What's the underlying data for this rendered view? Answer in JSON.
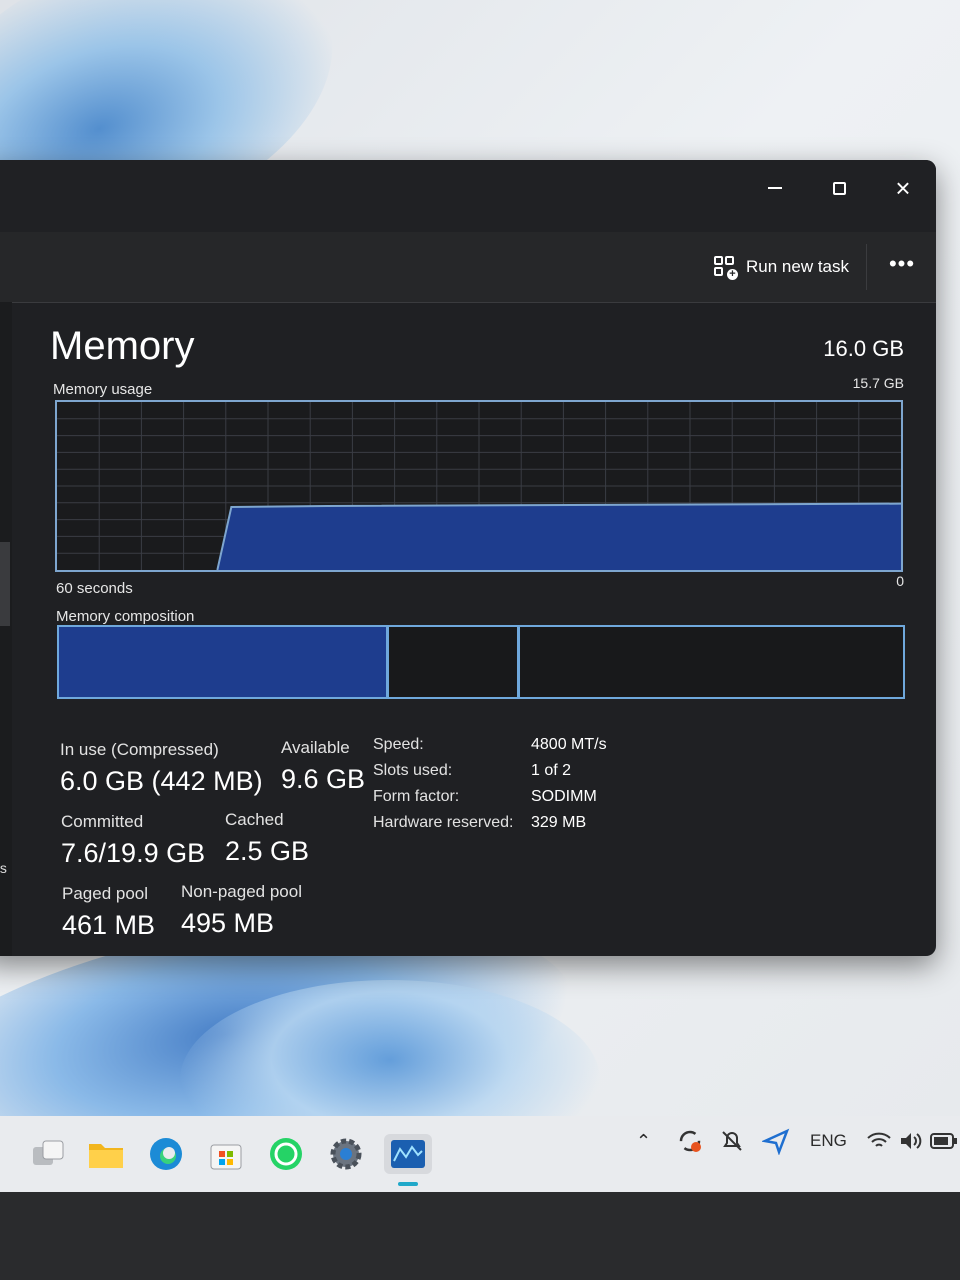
{
  "window": {
    "title_buttons": {
      "minimize": "minimize",
      "maximize": "maximize",
      "close": "×"
    },
    "command_bar": {
      "run_new_task": "Run new task",
      "more_options": "•••"
    },
    "left_nav_fragments": [
      "ts",
      "..."
    ]
  },
  "memory": {
    "title": "Memory",
    "total": "16.0 GB",
    "usage_label": "Memory usage",
    "usage_max": "15.7 GB",
    "time_label": "60 seconds",
    "zero_label": "0",
    "composition_label": "Memory composition",
    "composition": {
      "in_use_fraction": 0.39,
      "modified_fraction": 0.155,
      "free_fraction": 0.455
    },
    "usage_history": {
      "start_fraction": 0.19,
      "level_fraction_start": 0.375,
      "level_fraction_end": 0.395
    },
    "stats": {
      "in_use_label": "In use (Compressed)",
      "in_use_value": "6.0 GB (442 MB)",
      "available_label": "Available",
      "available_value": "9.6 GB",
      "committed_label": "Committed",
      "committed_value": "7.6/19.9 GB",
      "cached_label": "Cached",
      "cached_value": "2.5 GB",
      "paged_pool_label": "Paged pool",
      "paged_pool_value": "461 MB",
      "nonpaged_pool_label": "Non-paged pool",
      "nonpaged_pool_value": "495 MB"
    },
    "specs": [
      {
        "label": "Speed:",
        "value": "4800 MT/s"
      },
      {
        "label": "Slots used:",
        "value": "1 of 2"
      },
      {
        "label": "Form factor:",
        "value": "SODIMM"
      },
      {
        "label": "Hardware reserved:",
        "value": "329 MB"
      }
    ]
  },
  "taskbar": {
    "apps": [
      "task-view-icon",
      "file-explorer-icon",
      "edge-icon",
      "microsoft-store-icon",
      "whatsapp-icon",
      "settings-icon",
      "task-manager-icon"
    ],
    "tray": {
      "language": "ENG"
    }
  },
  "colors": {
    "window_bg": "#1f2023",
    "graph_fill": "#1e3d8e",
    "graph_line": "#7ea6cf",
    "accent": "#20a8c9"
  }
}
